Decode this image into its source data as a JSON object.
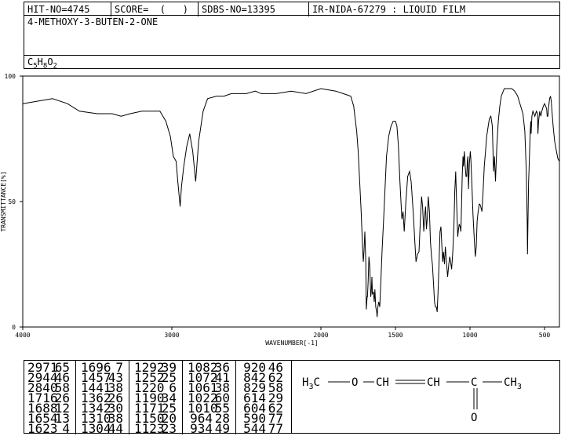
{
  "header": {
    "hit_no": "HIT-NO=4745",
    "score": "SCORE=  (   )",
    "sdbs_no": "SDBS-NO=13395",
    "ir_info": "IR-NIDA-67279 : LIQUID FILM"
  },
  "compound": {
    "name": "4-METHOXY-3-BUTEN-2-ONE",
    "formula": {
      "c": "C",
      "c_n": "5",
      "h": "H",
      "h_n": "8",
      "o": "O",
      "o_n": "2"
    }
  },
  "chart_data": {
    "type": "line",
    "title": "",
    "xlabel": "WAVENUMBER[-1]",
    "ylabel": "TRANSMITTANCE[%]",
    "xlim": [
      4000,
      400
    ],
    "ylim": [
      0,
      100
    ],
    "x_ticks": [
      {
        "value": 4000,
        "label": "4000"
      },
      {
        "value": 3000,
        "label": "3000"
      },
      {
        "value": 2000,
        "label": "2000"
      },
      {
        "value": 1500,
        "label": "1500"
      },
      {
        "value": 1000,
        "label": "1000"
      },
      {
        "value": 500,
        "label": "500"
      }
    ],
    "y_ticks": [
      {
        "value": 100,
        "label": "100"
      },
      {
        "value": 50,
        "label": "50"
      },
      {
        "value": 0,
        "label": "0"
      }
    ],
    "grid": false,
    "series": [
      {
        "color": "#000000",
        "points": [
          [
            4000,
            89
          ],
          [
            3900,
            90
          ],
          [
            3800,
            91
          ],
          [
            3700,
            89
          ],
          [
            3620,
            86
          ],
          [
            3500,
            85
          ],
          [
            3400,
            85
          ],
          [
            3340,
            84
          ],
          [
            3280,
            85
          ],
          [
            3200,
            86
          ],
          [
            3120,
            86
          ],
          [
            3080,
            86
          ],
          [
            3040,
            82
          ],
          [
            3010,
            76
          ],
          [
            2990,
            68
          ],
          [
            2971,
            66
          ],
          [
            2960,
            58
          ],
          [
            2944,
            48
          ],
          [
            2935,
            56
          ],
          [
            2920,
            64
          ],
          [
            2900,
            72
          ],
          [
            2880,
            77
          ],
          [
            2860,
            70
          ],
          [
            2840,
            58
          ],
          [
            2820,
            74
          ],
          [
            2790,
            86
          ],
          [
            2760,
            91
          ],
          [
            2700,
            92
          ],
          [
            2650,
            92
          ],
          [
            2600,
            93
          ],
          [
            2500,
            93
          ],
          [
            2440,
            94
          ],
          [
            2400,
            93
          ],
          [
            2300,
            93
          ],
          [
            2200,
            94
          ],
          [
            2100,
            93
          ],
          [
            2000,
            95
          ],
          [
            1900,
            94
          ],
          [
            1850,
            93
          ],
          [
            1800,
            92
          ],
          [
            1780,
            88
          ],
          [
            1760,
            78
          ],
          [
            1750,
            70
          ],
          [
            1740,
            58
          ],
          [
            1730,
            46
          ],
          [
            1722,
            34
          ],
          [
            1716,
            26
          ],
          [
            1711,
            30
          ],
          [
            1705,
            38
          ],
          [
            1699,
            26
          ],
          [
            1696,
            7
          ],
          [
            1690,
            12
          ],
          [
            1688,
            12
          ],
          [
            1683,
            18
          ],
          [
            1678,
            28
          ],
          [
            1672,
            24
          ],
          [
            1666,
            12
          ],
          [
            1662,
            14
          ],
          [
            1658,
            20
          ],
          [
            1654,
            13
          ],
          [
            1648,
            14
          ],
          [
            1642,
            10
          ],
          [
            1638,
            15
          ],
          [
            1632,
            8
          ],
          [
            1626,
            6
          ],
          [
            1623,
            4
          ],
          [
            1618,
            8
          ],
          [
            1612,
            10
          ],
          [
            1605,
            8
          ],
          [
            1598,
            18
          ],
          [
            1590,
            30
          ],
          [
            1580,
            42
          ],
          [
            1570,
            55
          ],
          [
            1560,
            68
          ],
          [
            1545,
            76
          ],
          [
            1530,
            80
          ],
          [
            1515,
            82
          ],
          [
            1500,
            82
          ],
          [
            1490,
            80
          ],
          [
            1480,
            72
          ],
          [
            1470,
            58
          ],
          [
            1457,
            43
          ],
          [
            1449,
            46
          ],
          [
            1441,
            38
          ],
          [
            1430,
            50
          ],
          [
            1418,
            60
          ],
          [
            1405,
            62
          ],
          [
            1395,
            58
          ],
          [
            1380,
            45
          ],
          [
            1370,
            34
          ],
          [
            1362,
            26
          ],
          [
            1352,
            29
          ],
          [
            1342,
            30
          ],
          [
            1335,
            40
          ],
          [
            1325,
            52
          ],
          [
            1318,
            48
          ],
          [
            1310,
            38
          ],
          [
            1304,
            44
          ],
          [
            1298,
            48
          ],
          [
            1292,
            39
          ],
          [
            1286,
            44
          ],
          [
            1280,
            52
          ],
          [
            1272,
            46
          ],
          [
            1265,
            34
          ],
          [
            1258,
            28
          ],
          [
            1252,
            25
          ],
          [
            1245,
            18
          ],
          [
            1238,
            10
          ],
          [
            1232,
            8
          ],
          [
            1226,
            8
          ],
          [
            1220,
            6
          ],
          [
            1214,
            14
          ],
          [
            1208,
            25
          ],
          [
            1201,
            38
          ],
          [
            1195,
            40
          ],
          [
            1190,
            34
          ],
          [
            1183,
            26
          ],
          [
            1178,
            30
          ],
          [
            1171,
            25
          ],
          [
            1165,
            32
          ],
          [
            1158,
            26
          ],
          [
            1150,
            20
          ],
          [
            1142,
            25
          ],
          [
            1136,
            28
          ],
          [
            1130,
            26
          ],
          [
            1123,
            23
          ],
          [
            1115,
            30
          ],
          [
            1108,
            40
          ],
          [
            1102,
            54
          ],
          [
            1096,
            62
          ],
          [
            1090,
            50
          ],
          [
            1082,
            36
          ],
          [
            1077,
            39
          ],
          [
            1072,
            41
          ],
          [
            1066,
            40
          ],
          [
            1061,
            38
          ],
          [
            1057,
            48
          ],
          [
            1052,
            60
          ],
          [
            1047,
            68
          ],
          [
            1043,
            64
          ],
          [
            1038,
            70
          ],
          [
            1032,
            64
          ],
          [
            1027,
            60
          ],
          [
            1022,
            60
          ],
          [
            1018,
            66
          ],
          [
            1014,
            68
          ],
          [
            1010,
            55
          ],
          [
            1004,
            65
          ],
          [
            998,
            70
          ],
          [
            994,
            67
          ],
          [
            988,
            58
          ],
          [
            980,
            45
          ],
          [
            972,
            36
          ],
          [
            964,
            28
          ],
          [
            958,
            32
          ],
          [
            952,
            42
          ],
          [
            945,
            46
          ],
          [
            938,
            49
          ],
          [
            934,
            49
          ],
          [
            928,
            48
          ],
          [
            920,
            46
          ],
          [
            912,
            54
          ],
          [
            904,
            64
          ],
          [
            896,
            70
          ],
          [
            888,
            76
          ],
          [
            878,
            80
          ],
          [
            870,
            83
          ],
          [
            860,
            84
          ],
          [
            850,
            80
          ],
          [
            842,
            62
          ],
          [
            836,
            68
          ],
          [
            829,
            58
          ],
          [
            820,
            72
          ],
          [
            810,
            82
          ],
          [
            800,
            88
          ],
          [
            790,
            92
          ],
          [
            770,
            95
          ],
          [
            750,
            95
          ],
          [
            720,
            95
          ],
          [
            700,
            94
          ],
          [
            680,
            92
          ],
          [
            660,
            88
          ],
          [
            645,
            85
          ],
          [
            632,
            78
          ],
          [
            622,
            62
          ],
          [
            616,
            40
          ],
          [
            614,
            29
          ],
          [
            611,
            42
          ],
          [
            607,
            58
          ],
          [
            604,
            62
          ],
          [
            600,
            70
          ],
          [
            596,
            78
          ],
          [
            592,
            82
          ],
          [
            590,
            77
          ],
          [
            585,
            84
          ],
          [
            578,
            86
          ],
          [
            565,
            84
          ],
          [
            555,
            86
          ],
          [
            547,
            85
          ],
          [
            544,
            77
          ],
          [
            540,
            82
          ],
          [
            532,
            86
          ],
          [
            525,
            84
          ],
          [
            518,
            86
          ],
          [
            508,
            88
          ],
          [
            500,
            89
          ],
          [
            492,
            88
          ],
          [
            486,
            87
          ],
          [
            482,
            84
          ],
          [
            478,
            84
          ],
          [
            472,
            88
          ],
          [
            466,
            91
          ],
          [
            460,
            92
          ],
          [
            455,
            90
          ],
          [
            450,
            86
          ],
          [
            442,
            80
          ],
          [
            432,
            74
          ],
          [
            420,
            70
          ],
          [
            410,
            67
          ],
          [
            400,
            66
          ]
        ]
      }
    ]
  },
  "peak_table": {
    "columns": [
      [
        [
          "2971",
          "65"
        ],
        [
          "2944",
          "46"
        ],
        [
          "2840",
          "58"
        ],
        [
          "1716",
          "26"
        ],
        [
          "1688",
          "12"
        ],
        [
          "1654",
          "13"
        ],
        [
          "1623",
          "4"
        ]
      ],
      [
        [
          "1696",
          "7"
        ],
        [
          "1457",
          "43"
        ],
        [
          "1441",
          "38"
        ],
        [
          "1362",
          "26"
        ],
        [
          "1342",
          "30"
        ],
        [
          "1310",
          "38"
        ],
        [
          "1304",
          "44"
        ]
      ],
      [
        [
          "1292",
          "39"
        ],
        [
          "1252",
          "25"
        ],
        [
          "1220",
          "6"
        ],
        [
          "1190",
          "34"
        ],
        [
          "1171",
          "25"
        ],
        [
          "1150",
          "20"
        ],
        [
          "1123",
          "23"
        ]
      ],
      [
        [
          "1082",
          "36"
        ],
        [
          "1072",
          "41"
        ],
        [
          "1061",
          "38"
        ],
        [
          "1022",
          "60"
        ],
        [
          "1010",
          "55"
        ],
        [
          "964",
          "28"
        ],
        [
          "934",
          "49"
        ]
      ],
      [
        [
          "920",
          "46"
        ],
        [
          "842",
          "62"
        ],
        [
          "829",
          "58"
        ],
        [
          "614",
          "29"
        ],
        [
          "604",
          "62"
        ],
        [
          "590",
          "77"
        ],
        [
          "544",
          "77"
        ]
      ]
    ]
  },
  "structure": {
    "ch3_left": "H3C",
    "o": "O",
    "ch1": "CH",
    "ch2": "CH",
    "c": "C",
    "ch3_right": "CH3",
    "carbonyl_o": "O"
  }
}
